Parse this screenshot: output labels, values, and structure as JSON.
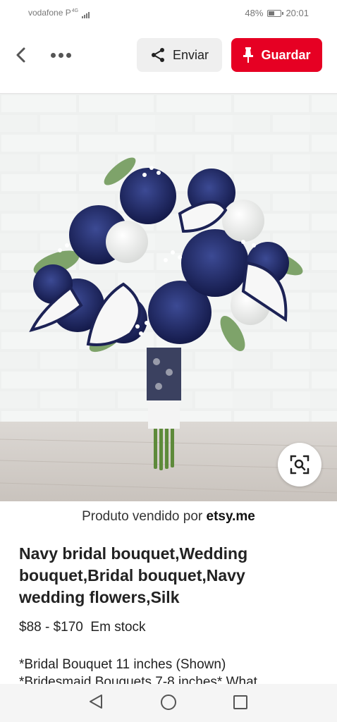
{
  "status_bar": {
    "carrier": "vodafone P",
    "network": "4G",
    "battery": "48%",
    "battery_level": 0.48,
    "time": "20:01"
  },
  "toolbar": {
    "back_icon": "chevron-left-icon",
    "more_icon": "more-horizontal-icon",
    "send_label": "Enviar",
    "send_icon": "share-icon",
    "save_label": "Guardar",
    "save_icon": "pin-icon",
    "save_color": "#e60023"
  },
  "product": {
    "image_alt": "Navy bridal bouquet",
    "seller_prefix": "Produto vendido por",
    "seller_domain": "etsy.me",
    "title": "Navy bridal bouquet,Wedding bouquet,Bridal bouquet,Navy wedding flowers,Silk",
    "price": "$88 - $170",
    "stock": "Em stock",
    "description_line1": "*Bridal Bouquet 11 inches (Shown)",
    "description_line2": "*Bridesmaid Bouquets 7-8 inches* What"
  },
  "navbar": {
    "back_icon": "triangle-back-icon",
    "home_icon": "circle-home-icon",
    "recent_icon": "square-recents-icon"
  }
}
